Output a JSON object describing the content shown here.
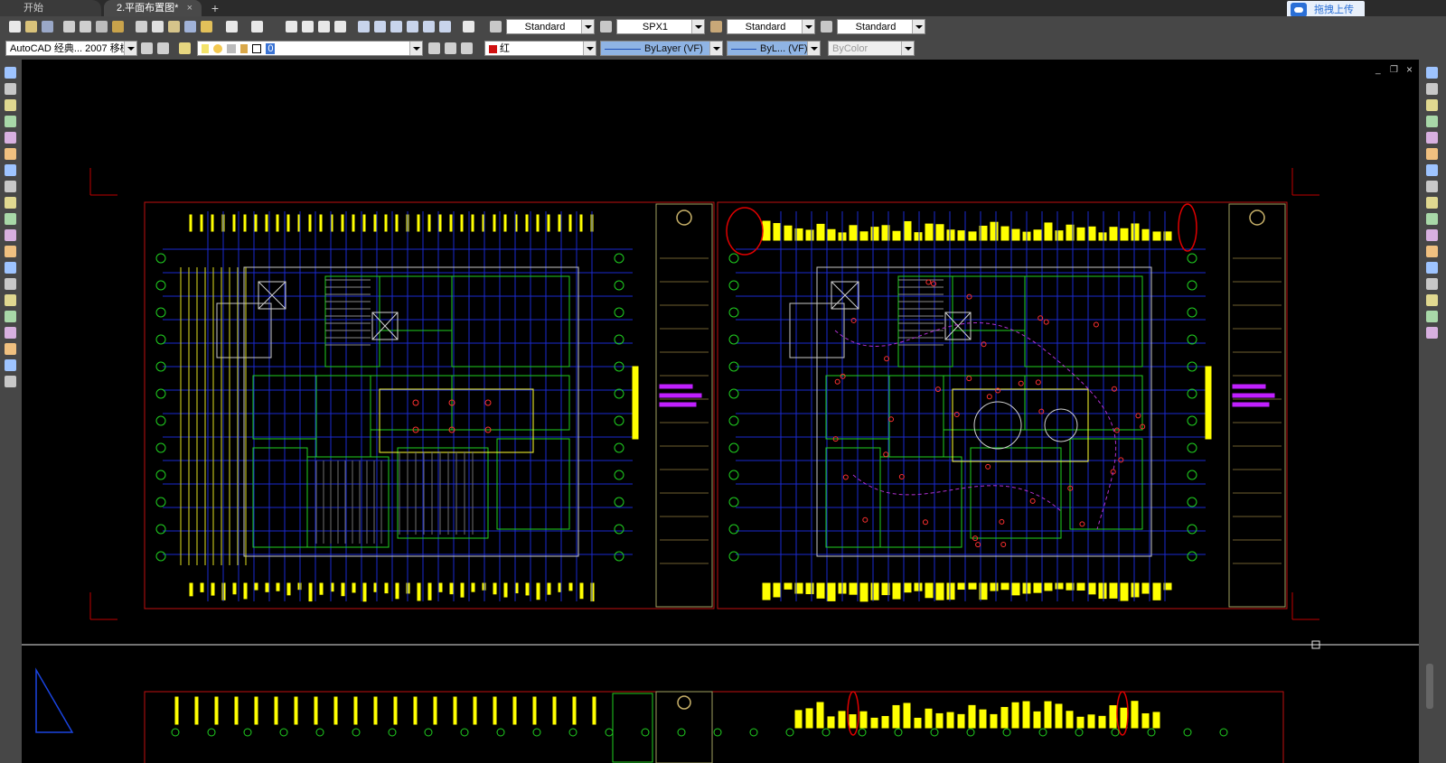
{
  "tabs": {
    "start": "开始",
    "drawing": "2.平面布置图*",
    "close_glyph": "×",
    "add_glyph": "+"
  },
  "upload": {
    "label": "拖拽上传"
  },
  "toolbar": {
    "text_style": "Standard",
    "dim_style": "SPX1",
    "table_style": "Standard",
    "multileader_style": "Standard"
  },
  "layers": {
    "workspace": "AutoCAD 经典... 2007 移植",
    "current_layer": "0",
    "color": "红",
    "linetype": "ByLayer  (VF)",
    "lineweight": "ByL... (VF)",
    "plotstyle": "ByColor"
  },
  "window_controls": {
    "minimize": "_",
    "restore": "❐",
    "close": "×"
  },
  "tool_icons": {
    "left": [
      "line",
      "construction-line",
      "polyline",
      "polygon",
      "rectangle",
      "arc",
      "circle",
      "revision-cloud",
      "spline",
      "ellipse",
      "ellipse-arc",
      "insert-block",
      "make-block",
      "point",
      "hatch",
      "gradient",
      "region",
      "table",
      "multiline-text",
      "add-selected"
    ],
    "right": [
      "erase",
      "copy",
      "mirror",
      "offset",
      "array",
      "move",
      "rotate",
      "scale",
      "stretch",
      "trim",
      "extend",
      "break-at-point",
      "break",
      "join",
      "chamfer",
      "fillet",
      "explode"
    ]
  },
  "accent_colors": {
    "layer_color_swatch": "#d01010",
    "upload_brand": "#2a6fd6"
  }
}
